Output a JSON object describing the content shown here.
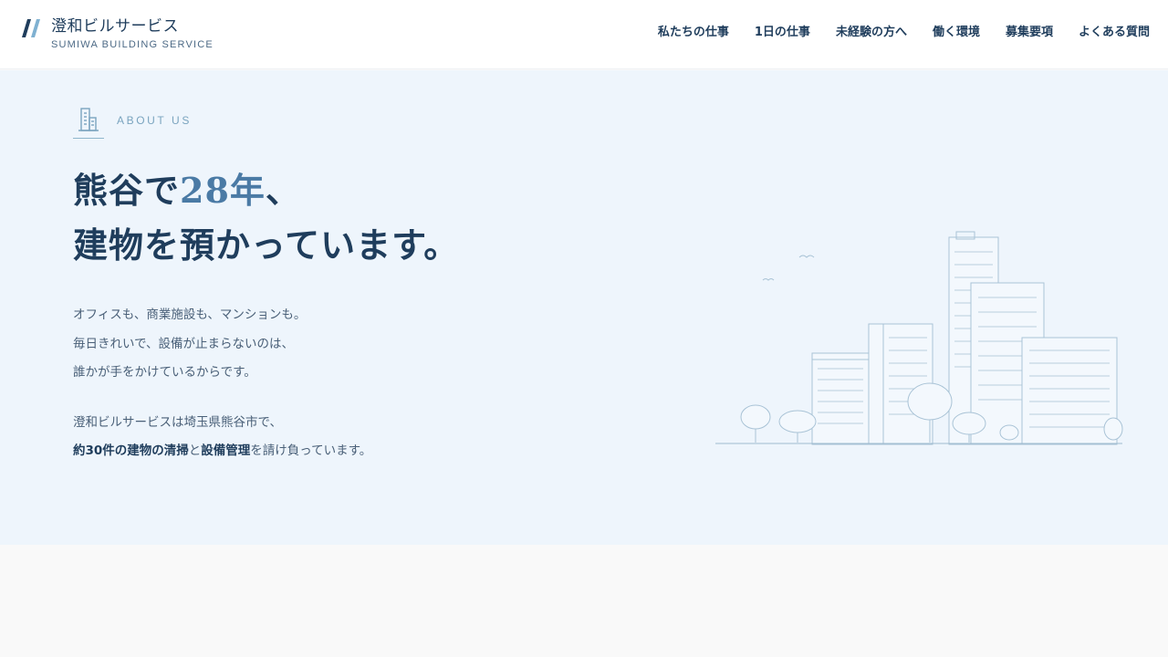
{
  "brand": {
    "name_jp": "澄和ビルサービス",
    "name_en": "SUMIWA BUILDING SERVICE",
    "colors": {
      "primary": "#1f3d5c",
      "accent": "#4a7aa5",
      "light_accent": "#7aa4bf",
      "hero_bg": "#eef5fc"
    }
  },
  "nav": {
    "items": [
      {
        "label": "私たちの仕事"
      },
      {
        "label": "1日の仕事"
      },
      {
        "label": "未経験の方へ"
      },
      {
        "label": "働く環境"
      },
      {
        "label": "募集要項"
      },
      {
        "label": "よくある質問"
      }
    ]
  },
  "hero": {
    "section_label": "ABOUT US",
    "section_icon": "building-icon",
    "heading": {
      "line1_prefix": "熊谷で",
      "line1_accent": "28年",
      "line1_suffix": "、",
      "line2": "建物を預かっています。"
    },
    "paragraph1": [
      "オフィスも、商業施設も、マンションも。",
      "毎日きれいで、設備が止まらないのは、",
      "誰かが手をかけているからです。"
    ],
    "paragraph2": {
      "line1": "澄和ビルサービスは埼玉県熊谷市で、",
      "line2_bold1": "約30件の建物の清掃",
      "line2_mid": "と",
      "line2_bold2": "設備管理",
      "line2_rest": "を請け負っています。"
    },
    "illustration": "city-buildings-illustration"
  }
}
